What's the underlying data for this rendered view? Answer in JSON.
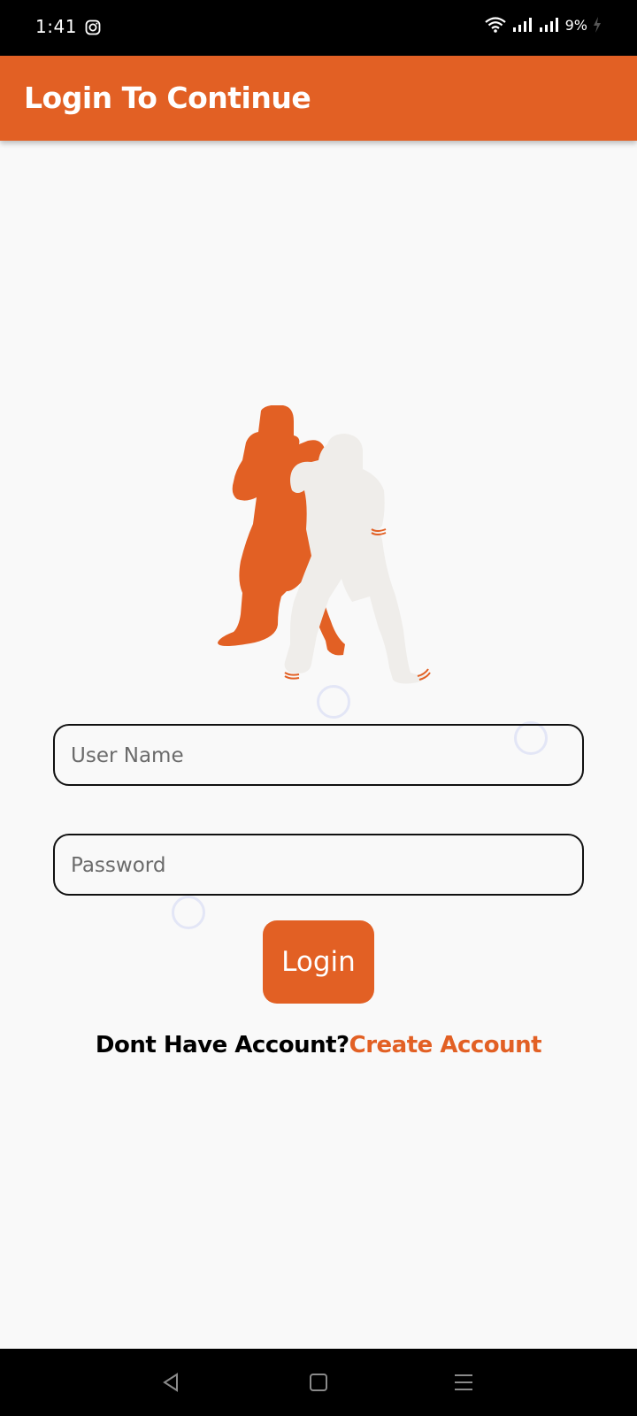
{
  "status_bar": {
    "time": "1:41",
    "battery": "9%",
    "icons": [
      "instagram-icon",
      "wifi-icon",
      "signal-icon",
      "signal-icon",
      "charging-icon"
    ]
  },
  "app_bar": {
    "title": "Login To Continue"
  },
  "illustration": {
    "icon": "boxers-illustration",
    "colors": {
      "front": "#e26024",
      "back": "#efedea"
    }
  },
  "form": {
    "username_placeholder": "User Name",
    "username_value": "",
    "password_placeholder": "Password",
    "password_value": "",
    "login_label": "Login"
  },
  "account": {
    "prompt": "Dont Have Account?",
    "create_label": "Create Account"
  },
  "nav_bar": {
    "buttons": [
      "back-icon",
      "home-icon",
      "menu-icon"
    ]
  },
  "colors": {
    "accent": "#e26024",
    "background": "#f9f9f9",
    "text": "#000000"
  }
}
